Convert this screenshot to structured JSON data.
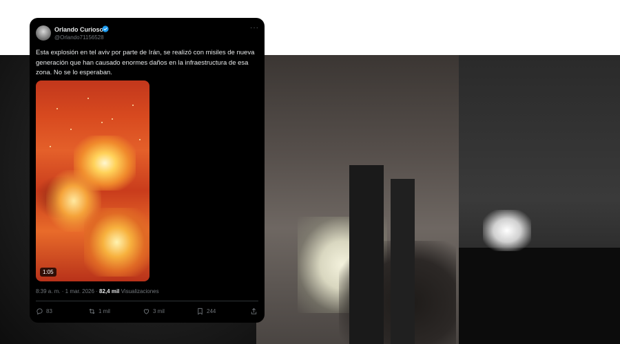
{
  "tweet": {
    "display_name": "Orlando Curioso",
    "handle": "@Orlando71156528",
    "more_icon": "more-horizontal-icon",
    "text": "Esta explosión en tel aviv por parte de Irán, se realizó con misiles de nueva generación que han causado enormes daños en la infraestructura de esa zona. No se lo esperaban.",
    "video_duration": "1:05",
    "timestamp": "8:39 a. m. · 1 mar. 2026 · ",
    "views_count": "82,4 mil",
    "views_label": " Visualizaciones",
    "actions": {
      "replies": "83",
      "reposts": "1 mil",
      "likes": "3 mil",
      "bookmarks": "244"
    }
  },
  "colors": {
    "card_bg": "#000000",
    "primary_text": "#e7e9ea",
    "secondary_text": "#71767b",
    "verified_badge": "#1d9bf0"
  }
}
